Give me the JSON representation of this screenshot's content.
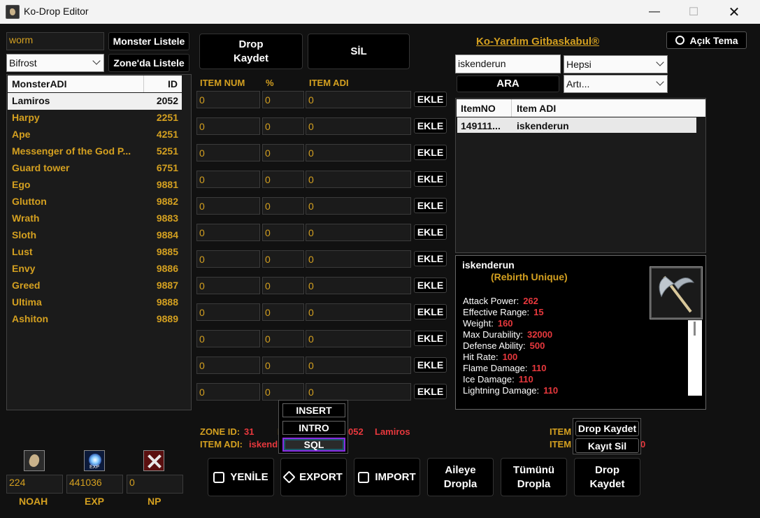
{
  "window": {
    "title": "Ko-Drop Editor"
  },
  "left": {
    "search_value": "worm",
    "monster_list_button": "Monster Listele",
    "zone_select": "Bifrost",
    "zone_list_button": "Zone'da Listele",
    "columns": [
      "MonsterADI",
      "ID"
    ],
    "monsters": [
      {
        "name": "Lamiros",
        "id": "2052"
      },
      {
        "name": "Harpy",
        "id": "2251"
      },
      {
        "name": "Ape",
        "id": "4251"
      },
      {
        "name": "Messenger of the God P...",
        "id": "5251"
      },
      {
        "name": "Guard tower",
        "id": "6751"
      },
      {
        "name": "Ego",
        "id": "9881"
      },
      {
        "name": "Glutton",
        "id": "9882"
      },
      {
        "name": "Wrath",
        "id": "9883"
      },
      {
        "name": "Sloth",
        "id": "9884"
      },
      {
        "name": "Lust",
        "id": "9885"
      },
      {
        "name": "Envy",
        "id": "9886"
      },
      {
        "name": "Greed",
        "id": "9887"
      },
      {
        "name": "Ultima",
        "id": "9888"
      },
      {
        "name": "Ashiton",
        "id": "9889"
      }
    ]
  },
  "currency": [
    {
      "value": "224",
      "label": "NOAH"
    },
    {
      "value": "441036",
      "label": "EXP"
    },
    {
      "value": "0",
      "label": "NP"
    }
  ],
  "middle": {
    "drop_save_button": "Drop\nKaydet",
    "delete_button": "SİL",
    "col_item_num": "ITEM NUM",
    "col_percent": "%",
    "col_item_name": "ITEM ADI",
    "rows": [
      {
        "num": "0",
        "pct": "0",
        "name": "0"
      },
      {
        "num": "0",
        "pct": "0",
        "name": "0"
      },
      {
        "num": "0",
        "pct": "0",
        "name": "0"
      },
      {
        "num": "0",
        "pct": "0",
        "name": "0"
      },
      {
        "num": "0",
        "pct": "0",
        "name": "0"
      },
      {
        "num": "0",
        "pct": "0",
        "name": "0"
      },
      {
        "num": "0",
        "pct": "0",
        "name": "0"
      },
      {
        "num": "0",
        "pct": "0",
        "name": "0"
      },
      {
        "num": "0",
        "pct": "0",
        "name": "0"
      },
      {
        "num": "0",
        "pct": "0",
        "name": "0"
      },
      {
        "num": "0",
        "pct": "0",
        "name": "0"
      },
      {
        "num": "0",
        "pct": "0",
        "name": "0"
      }
    ],
    "add_label": "EKLE",
    "zone_id_label": "ZONE ID:",
    "zone_id_value": "31",
    "item_label_partial": "I",
    "mob_id_partial": "052",
    "mob_name": "Lamiros",
    "item_adi_label": "ITEM ADI:",
    "item_adi_value_partial": "iskend",
    "popup": [
      "INSERT",
      "INTRO",
      "SQL"
    ]
  },
  "bottom_buttons": [
    {
      "label": "YENİLE",
      "icon": "refresh-icon"
    },
    {
      "label": "EXPORT",
      "icon": "box-icon"
    },
    {
      "label": "IMPORT",
      "icon": "import-icon"
    },
    {
      "label": "Aileye\nDropla"
    },
    {
      "label": "Tümünü\nDropla"
    },
    {
      "label": "Drop\nKaydet"
    }
  ],
  "right": {
    "link": "Ko-Yardım Gitbaskabul®",
    "theme_button": "Açık Tema",
    "search_value": "iskenderun",
    "type_select": "Hepsi",
    "search_button": "ARA",
    "plus_select": "Artı...",
    "columns": [
      "ItemNO",
      "Item ADI"
    ],
    "results": [
      {
        "no": "149111...",
        "name": "iskenderun"
      }
    ],
    "item_name": "iskenderun",
    "item_grade": "(Rebirth Unique)",
    "stats": [
      {
        "label": "Attack Power:",
        "value": "262"
      },
      {
        "label": "Effective Range:",
        "value": "15"
      },
      {
        "label": "Weight:",
        "value": "160"
      },
      {
        "label": "Max Durability:",
        "value": "32000"
      },
      {
        "label": "Defense Ability:",
        "value": "500"
      },
      {
        "label": "Hit Rate:",
        "value": "100"
      },
      {
        "label": "Flame Damage:",
        "value": "110"
      },
      {
        "label": "Ice Damage:",
        "value": "110"
      },
      {
        "label": "Lightning Damage:",
        "value": "110"
      }
    ],
    "item_label_a": "ITEM",
    "item_label_b": "ITEM",
    "partial_red": "0",
    "small_popup": [
      "Drop Kaydet",
      "Kayıt Sil"
    ]
  },
  "colors": {
    "gold": "#d4a020",
    "red": "#e8383d",
    "sql_border": "#8a2be2"
  }
}
